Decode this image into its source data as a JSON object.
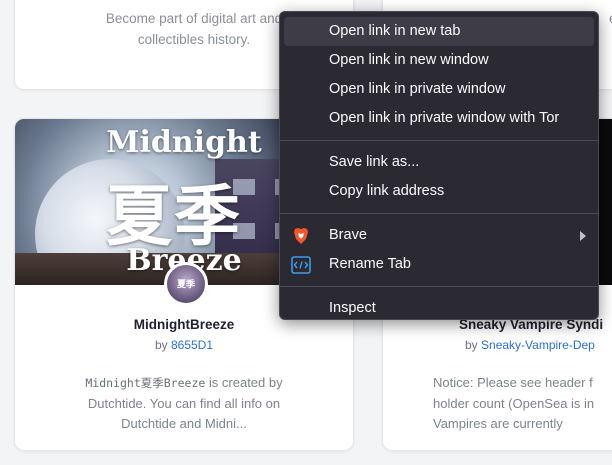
{
  "cards": {
    "top_left": {
      "description_line1": "Become part of digital art and",
      "description_line2": "collectibles history."
    },
    "top_right": {
      "description_line1": "e",
      "description_line2": ""
    },
    "midnight_breeze": {
      "banner_line1": "Midnight",
      "banner_line2": "夏季",
      "banner_line3": "Breeze",
      "avatar_text": "夏季",
      "name": "MidnightBreeze",
      "by_label": "by",
      "creator": "8655D1",
      "desc_mono": "Midnight夏季Breeze",
      "desc_text1": " is created by",
      "desc_line2": "Dutchtide. You can find all info on",
      "desc_line3": "Dutchtide and Midni..."
    },
    "sneaky_vampire": {
      "name": "Sneaky Vampire Syndi",
      "by_label": "by",
      "creator": "Sneaky-Vampire-Dep",
      "desc_line1": "Notice: Please see header f",
      "desc_line2": "holder count (OpenSea is in",
      "desc_line3": "Vampires are currently"
    }
  },
  "context_menu": {
    "items": [
      {
        "label": "Open link in new tab"
      },
      {
        "label": "Open link in new window"
      },
      {
        "label": "Open link in private window"
      },
      {
        "label": "Open link in private window with Tor"
      },
      {
        "label": "Save link as..."
      },
      {
        "label": "Copy link address"
      },
      {
        "label": "Brave",
        "icon": "brave-lion-icon",
        "submenu": true
      },
      {
        "label": "Rename Tab",
        "icon": "code-tab-icon"
      },
      {
        "label": "Inspect"
      }
    ]
  },
  "colors": {
    "menu_bg": "#2b2a33",
    "menu_hover": "#3e3d47",
    "link": "#2a6fd6",
    "brave_orange": "#fb542b",
    "rename_icon": "#3d9be9"
  }
}
